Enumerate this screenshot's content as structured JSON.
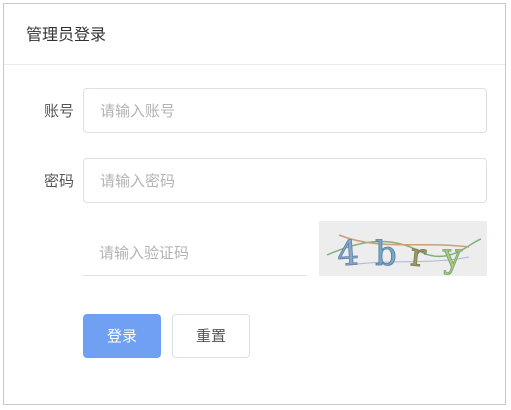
{
  "header": {
    "title": "管理员登录"
  },
  "form": {
    "account_label": "账号",
    "account_placeholder": "请输入账号",
    "password_label": "密码",
    "password_placeholder": "请输入密码",
    "captcha_placeholder": "请输入验证码",
    "captcha_text": "4bry"
  },
  "buttons": {
    "login_label": "登录",
    "reset_label": "重置"
  },
  "colors": {
    "primary": "#6fa0f2",
    "border": "#dcdfe6",
    "captcha_bg": "#ededed"
  }
}
